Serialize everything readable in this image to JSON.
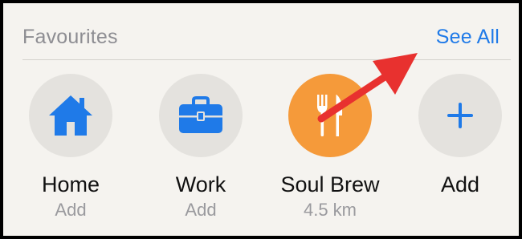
{
  "header": {
    "title": "Favourites",
    "see_all": "See All"
  },
  "favourites": [
    {
      "name": "Home",
      "sub": "Add",
      "icon": "house-icon"
    },
    {
      "name": "Work",
      "sub": "Add",
      "icon": "briefcase-icon"
    },
    {
      "name": "Soul Brew",
      "sub": "4.5 km",
      "icon": "fork-knife-icon"
    },
    {
      "name": "Add",
      "sub": "",
      "icon": "plus-icon"
    }
  ],
  "colors": {
    "accent_blue": "#1f7ae8",
    "restaurant_orange": "#f59a3a",
    "annotation_red": "#e8312f"
  }
}
